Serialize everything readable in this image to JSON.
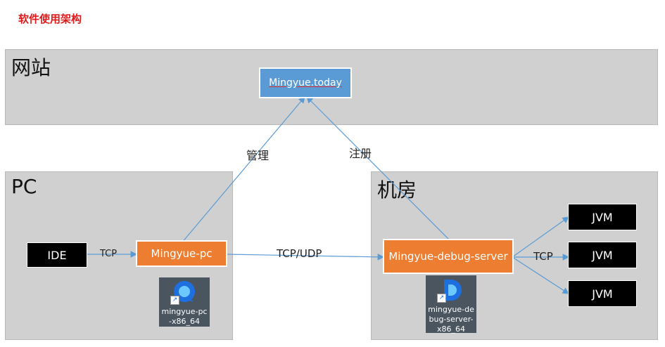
{
  "heading": "软件使用架构",
  "zones": {
    "website": "网站",
    "pc": "PC",
    "datacenter": "机房"
  },
  "nodes": {
    "site": "Mingyue.today",
    "ide": "IDE",
    "pc_client": "Mingyue-pc",
    "debug_server": "Mingyue-debug-server",
    "jvm1": "JVM",
    "jvm2": "JVM",
    "jvm3": "JVM"
  },
  "edges": {
    "ide_to_pc": "TCP",
    "pc_to_site": "管理",
    "server_to_site": "注册",
    "pc_to_server": "TCP/UDP",
    "server_to_jvm": "TCP"
  },
  "icons": {
    "pc_app": {
      "icon": "mingyue-q-icon",
      "label_line1": "mingyue-pc",
      "label_line2": "-x86_64"
    },
    "server_app": {
      "icon": "mingyue-d-icon",
      "label_line1": "mingyue-de",
      "label_line2": "bug-server-",
      "label_line3": "x86_64"
    }
  },
  "colors": {
    "heading": "#e01a1a",
    "zone": "#d0d0d0",
    "site_box": "#5b9bd5",
    "app_box": "#ed7d31",
    "jvm_box": "#000000",
    "arrow": "#5b9bd5"
  }
}
